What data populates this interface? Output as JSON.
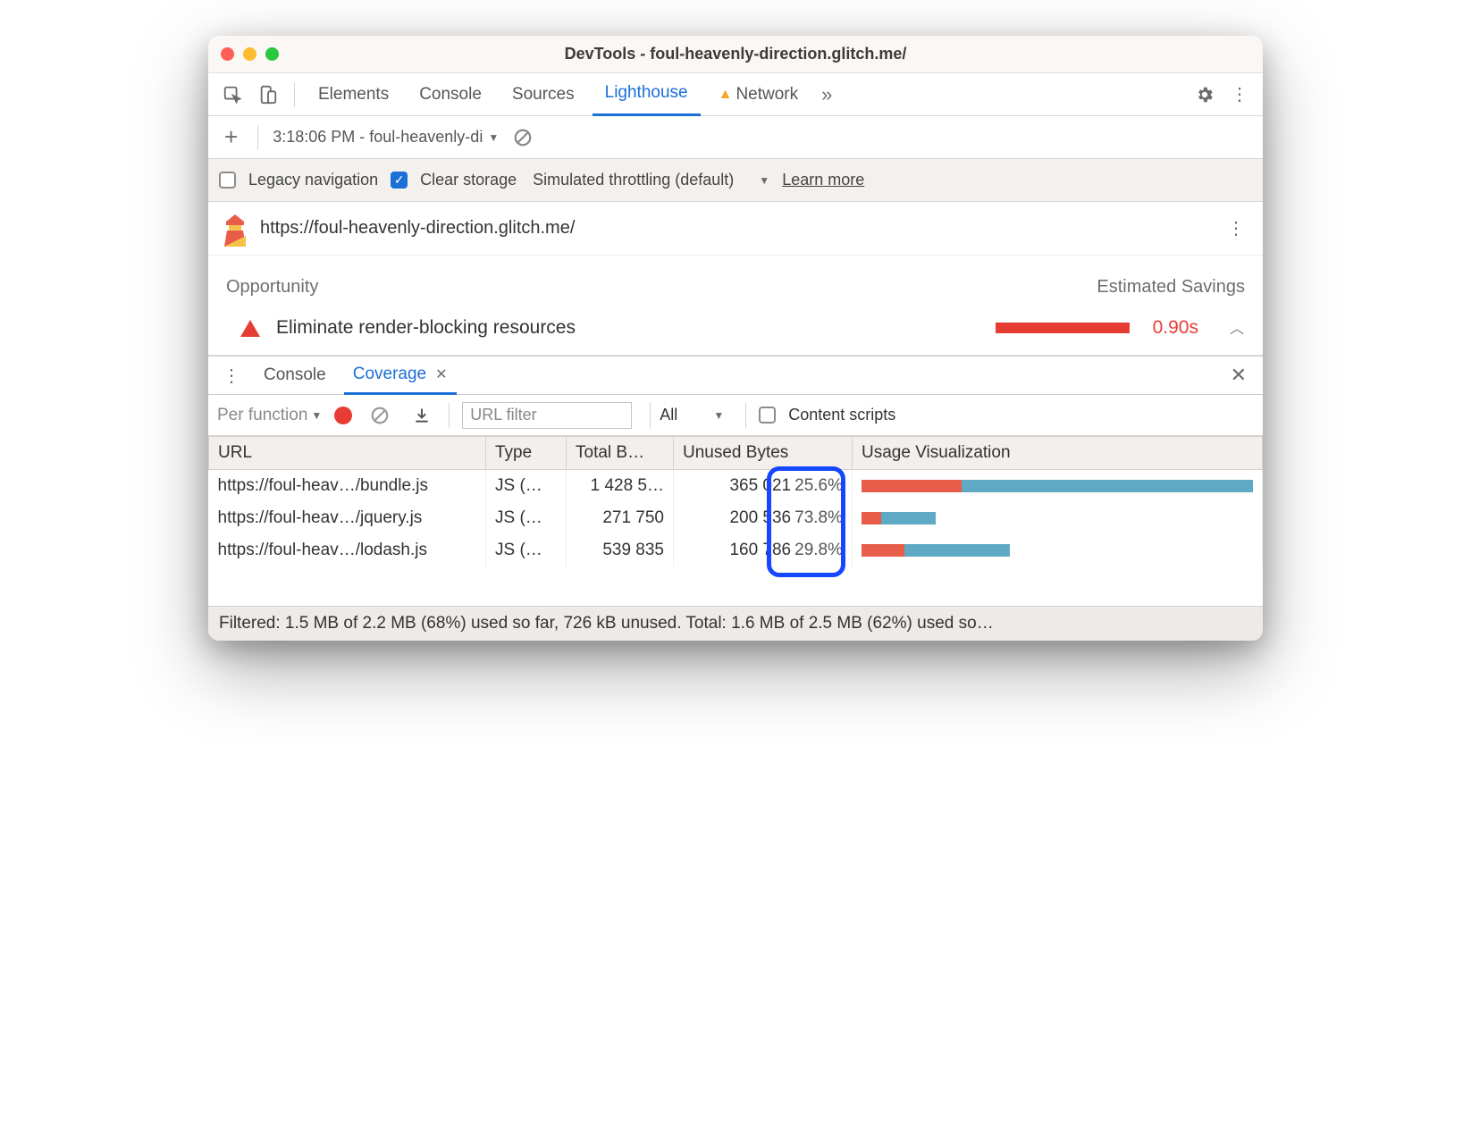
{
  "window": {
    "title": "DevTools - foul-heavenly-direction.glitch.me/"
  },
  "tabs": {
    "items": [
      "Elements",
      "Console",
      "Sources",
      "Lighthouse",
      "Network"
    ],
    "active_index": 3,
    "network_warning": true
  },
  "report_bar": {
    "dropdown_label": "3:18:06 PM - foul-heavenly-di"
  },
  "options": {
    "legacy_nav": {
      "label": "Legacy navigation",
      "checked": false
    },
    "clear_storage": {
      "label": "Clear storage",
      "checked": true
    },
    "throttling_label": "Simulated throttling (default)",
    "learn_more": "Learn more"
  },
  "url_row": {
    "url": "https://foul-heavenly-direction.glitch.me/"
  },
  "opportunities": {
    "header_left": "Opportunity",
    "header_right": "Estimated Savings",
    "items": [
      {
        "label": "Eliminate render-blocking resources",
        "value": "0.90s"
      }
    ]
  },
  "drawer": {
    "tabs": [
      "Console",
      "Coverage"
    ],
    "active_index": 1
  },
  "coverage_toolbar": {
    "per_type": "Per function",
    "url_filter_placeholder": "URL filter",
    "type_selector": "All",
    "content_scripts_label": "Content scripts",
    "content_scripts_checked": false
  },
  "coverage_table": {
    "columns": [
      "URL",
      "Type",
      "Total B…",
      "Unused Bytes",
      "Usage Visualization"
    ],
    "rows": [
      {
        "url": "https://foul-heav…/bundle.js",
        "type": "JS (…",
        "total": "1 428 5…",
        "unused_bytes": "365 021",
        "pct": "25.6%",
        "bar_used": 25.6,
        "bar_total": 100
      },
      {
        "url": "https://foul-heav…/jquery.js",
        "type": "JS (…",
        "total": "271 750",
        "unused_bytes": "200 536",
        "pct": "73.8%",
        "bar_used": 5,
        "bar_total": 19
      },
      {
        "url": "https://foul-heav…/lodash.js",
        "type": "JS (…",
        "total": "539 835",
        "unused_bytes": "160 786",
        "pct": "29.8%",
        "bar_used": 11,
        "bar_total": 38
      }
    ]
  },
  "coverage_footer": "Filtered: 1.5 MB of 2.2 MB (68%) used so far, 726 kB unused. Total: 1.6 MB of 2.5 MB (62%) used so…"
}
